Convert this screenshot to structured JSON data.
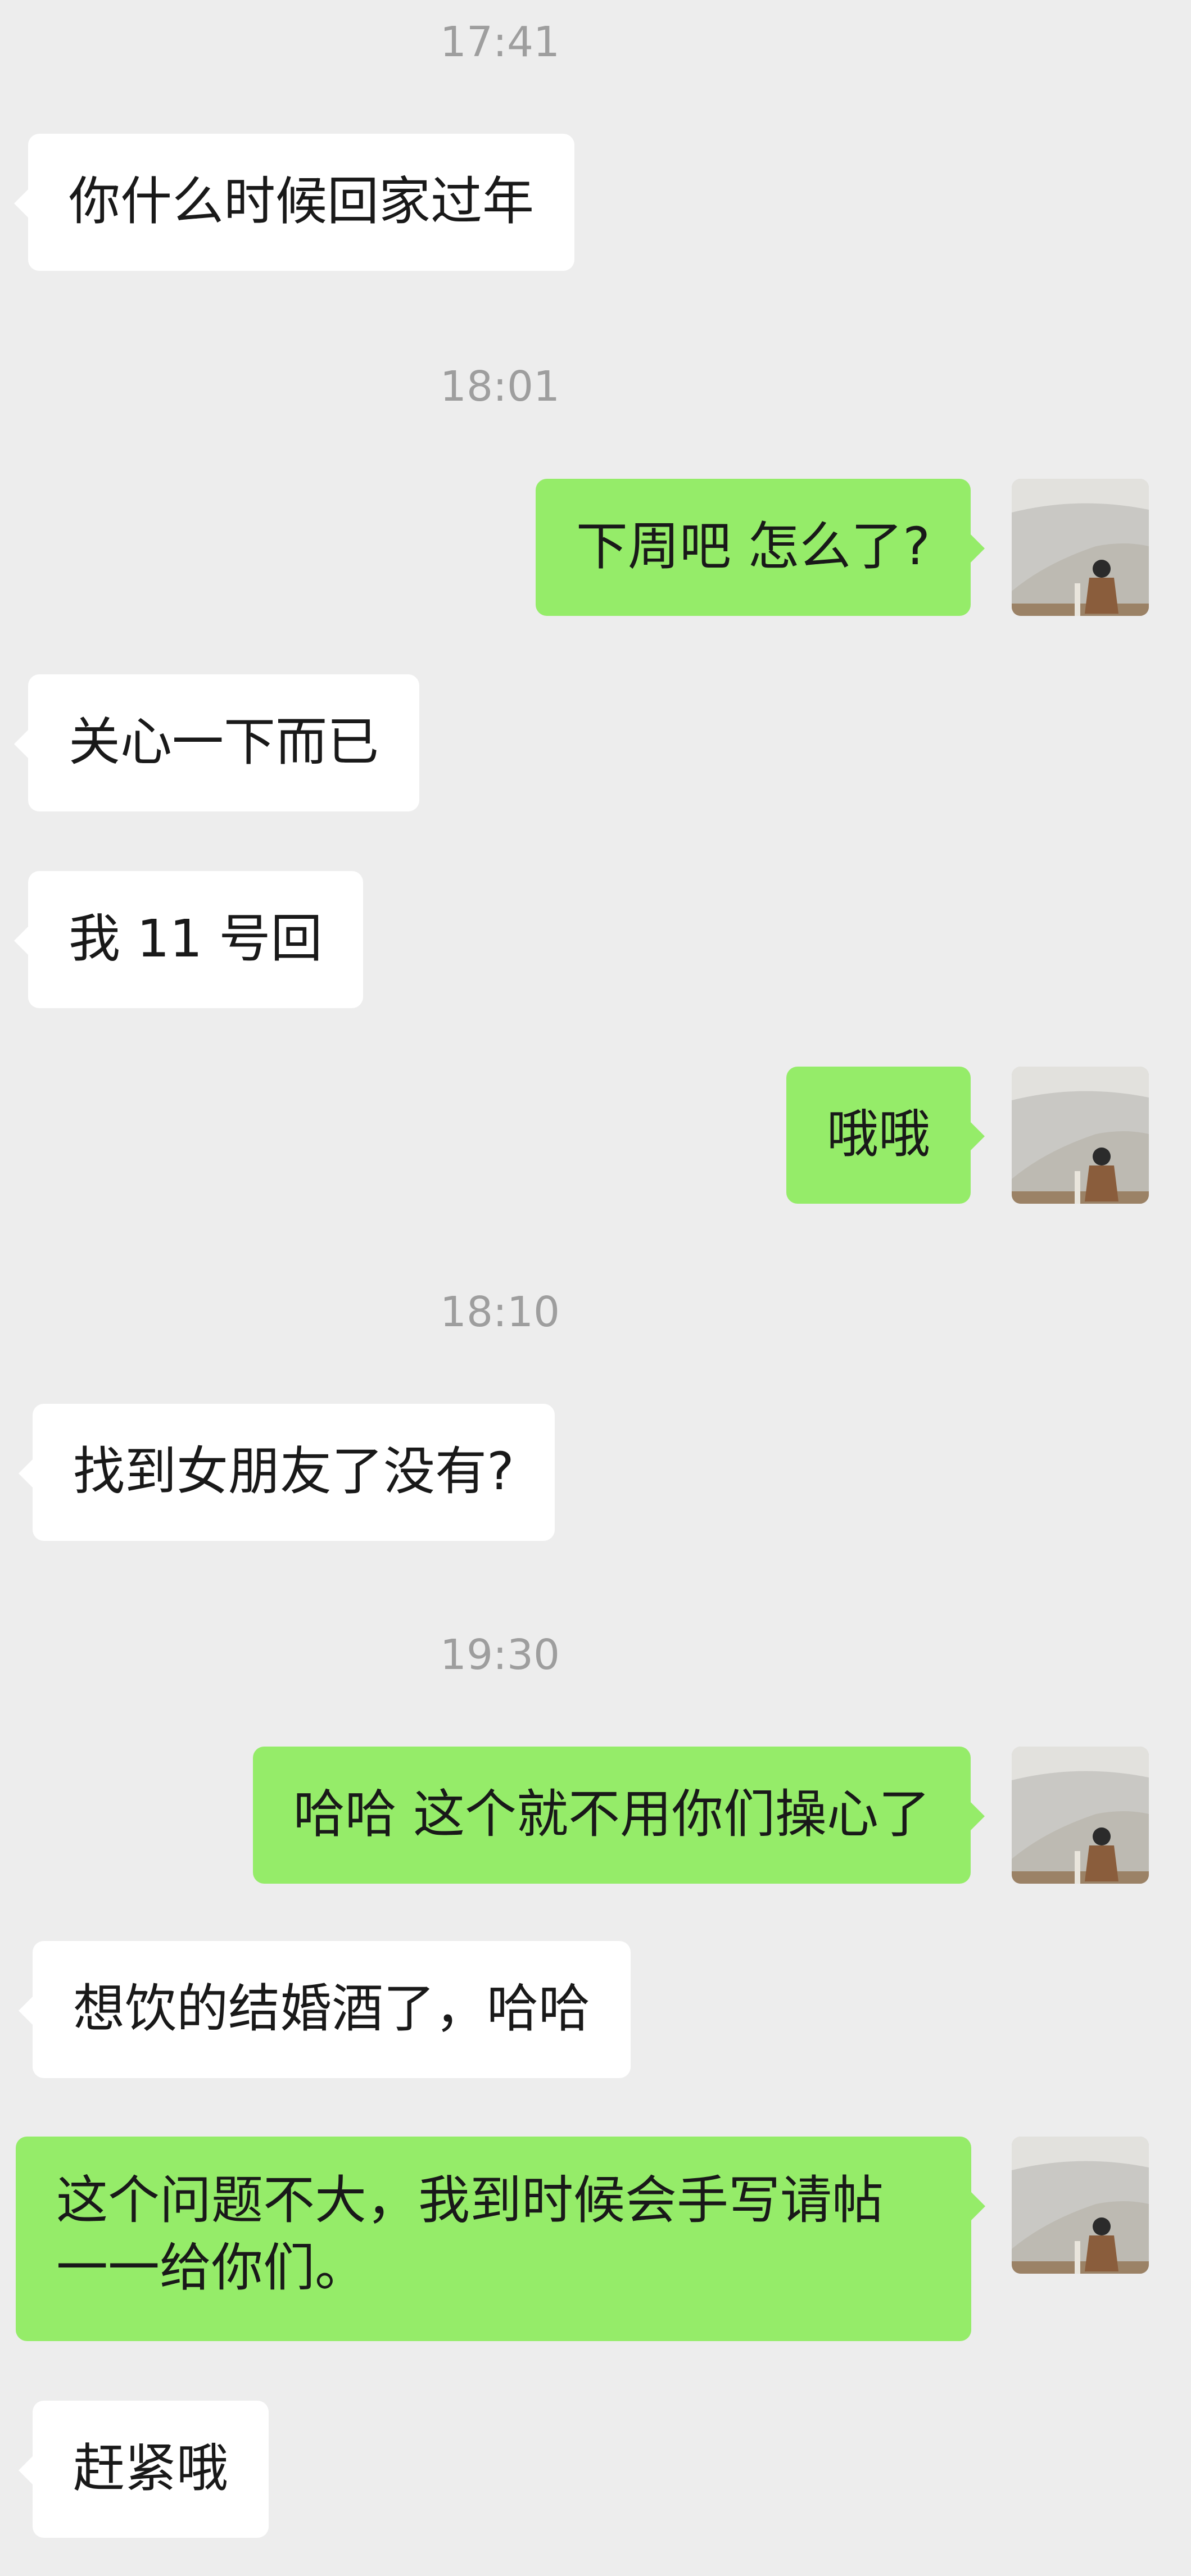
{
  "chat": {
    "timestamps": [
      "17:41",
      "18:01",
      "18:10",
      "19:30"
    ],
    "messages": [
      {
        "sender": "other",
        "text": "你什么时候回家过年"
      },
      {
        "sender": "me",
        "text": "下周吧 怎么了?"
      },
      {
        "sender": "other",
        "text": "关心一下而已"
      },
      {
        "sender": "other",
        "text": "我 11 号回"
      },
      {
        "sender": "me",
        "text": "哦哦"
      },
      {
        "sender": "other",
        "text": "找到女朋友了没有?"
      },
      {
        "sender": "me",
        "text": "哈哈 这个就不用你们操心了"
      },
      {
        "sender": "other",
        "text": "想饮的结婚酒了，哈哈"
      },
      {
        "sender": "me",
        "text": "这个问题不大，我到时候会手写请帖一一给你们。"
      },
      {
        "sender": "other",
        "text": "赶紧哦"
      }
    ]
  },
  "colors": {
    "background": "#ededed",
    "incoming_bubble": "#ffffff",
    "outgoing_bubble": "#95ec69",
    "timestamp_text": "#9e9e9e",
    "message_text": "#191919"
  },
  "icons": {
    "avatar": "user-avatar-photo"
  }
}
